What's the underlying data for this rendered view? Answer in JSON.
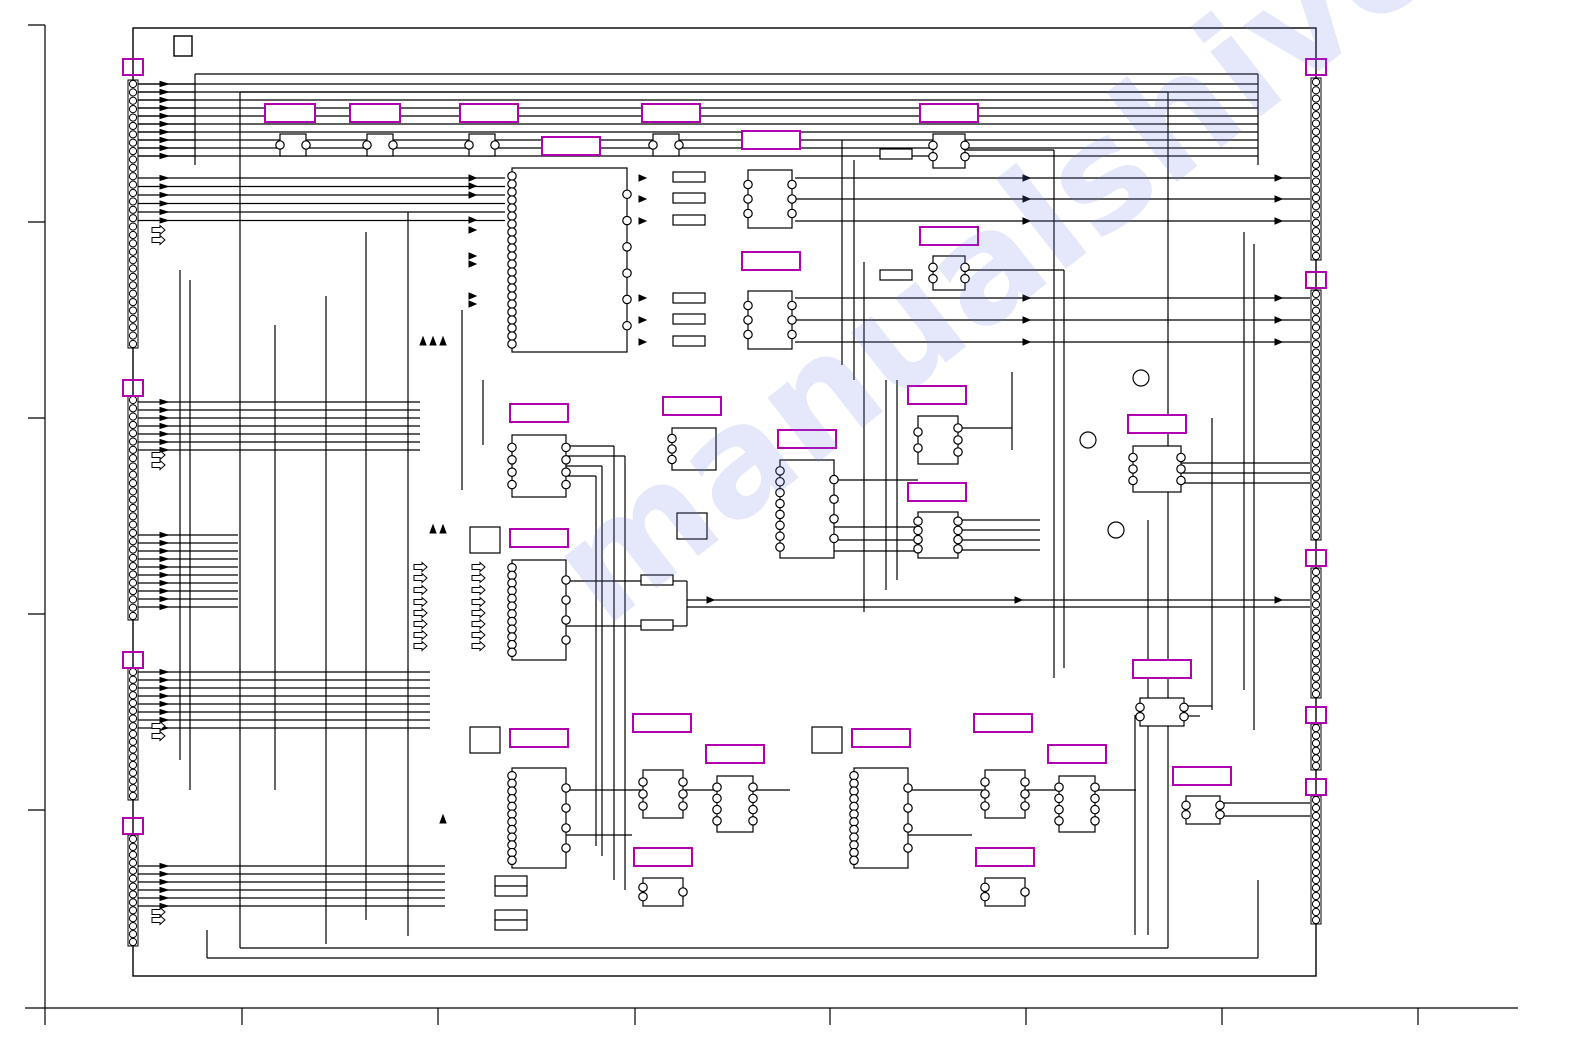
{
  "diagram": {
    "type": "circuit-schematic",
    "watermark_text": "manualshive.com",
    "colors": {
      "line": "#000000",
      "connector_label": "#b000b0",
      "watermark": "#6f7be6",
      "background": "#ffffff"
    },
    "ic_label_count": 25,
    "connector_count": 11,
    "grid_column_divisions": 7,
    "grid_row_divisions": 4
  }
}
